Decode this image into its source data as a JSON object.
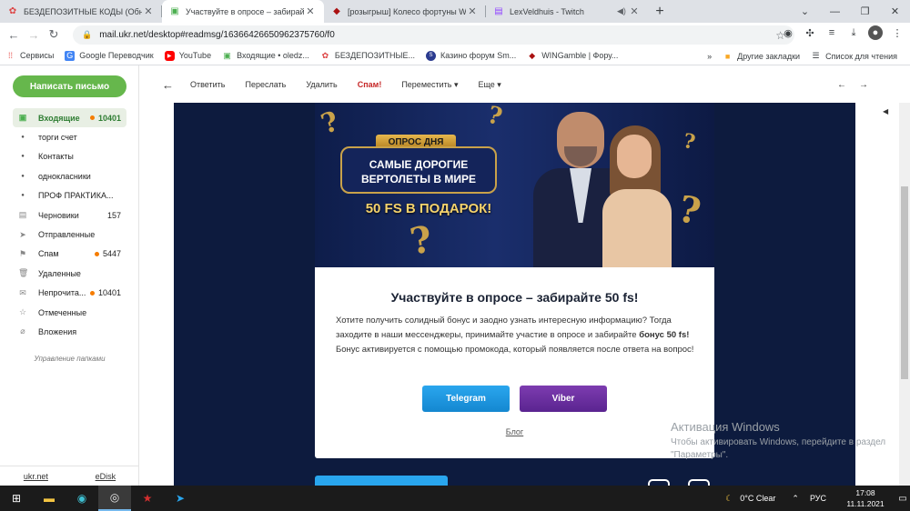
{
  "browser": {
    "tabs": [
      {
        "title": "БЕЗДЕПОЗИТНЫЕ КОДЫ (Обно",
        "icon": "flower-icon",
        "active": false
      },
      {
        "title": "Участвуйте в опросе – забирай",
        "icon": "ukrnet-icon",
        "active": true
      },
      {
        "title": "[розыгрыш] Колесо фортуны W",
        "icon": "wingamble-icon",
        "active": false
      },
      {
        "title": "LexVeldhuis - Twitch",
        "icon": "twitch-icon",
        "active": false
      }
    ],
    "url": "mail.ukr.net/desktop#readmsg/16366426650962375760/f0",
    "bookmarks": [
      {
        "label": "Сервисы",
        "icon": "apps-icon"
      },
      {
        "label": "Google Переводчик",
        "icon": "translate-icon"
      },
      {
        "label": "YouTube",
        "icon": "youtube-icon"
      },
      {
        "label": "Входящие • oledz...",
        "icon": "ukrnet-icon"
      },
      {
        "label": "БЕЗДЕПОЗИТНЫЕ...",
        "icon": "flower-icon"
      },
      {
        "label": "Казино форум Sm...",
        "icon": "casino-icon"
      },
      {
        "label": "WINGamble | Фору...",
        "icon": "wingamble-icon"
      }
    ],
    "bookmarks_more": "»",
    "other_bookmarks": "Другие закладки",
    "reading_list": "Список для чтения"
  },
  "sidebar": {
    "compose": "Написать письмо",
    "folders": [
      {
        "label": "Входящие",
        "count": "10401",
        "dot": true,
        "icon": "inbox-icon",
        "sub": false
      },
      {
        "label": "торги счет",
        "count": "",
        "dot": false,
        "icon": "bullet-icon",
        "sub": true
      },
      {
        "label": "Контакты",
        "count": "",
        "dot": false,
        "icon": "bullet-icon",
        "sub": true
      },
      {
        "label": "однокласники",
        "count": "",
        "dot": false,
        "icon": "bullet-icon",
        "sub": true
      },
      {
        "label": "ПРОФ ПРАКТИКА...",
        "count": "",
        "dot": false,
        "icon": "bullet-icon",
        "sub": true
      },
      {
        "label": "Черновики",
        "count": "157",
        "dot": false,
        "icon": "draft-icon",
        "sub": false
      },
      {
        "label": "Отправленные",
        "count": "",
        "dot": false,
        "icon": "send-icon",
        "sub": false
      },
      {
        "label": "Спам",
        "count": "5447",
        "dot": true,
        "icon": "spam-icon",
        "sub": false
      },
      {
        "label": "Удаленные",
        "count": "",
        "dot": false,
        "icon": "trash-icon",
        "sub": false
      },
      {
        "label": "Непрочита...",
        "count": "10401",
        "dot": true,
        "icon": "unread-icon",
        "sub": false
      },
      {
        "label": "Отмеченные",
        "count": "",
        "dot": false,
        "icon": "star-icon",
        "sub": false
      },
      {
        "label": "Вложения",
        "count": "",
        "dot": false,
        "icon": "attachment-icon",
        "sub": false
      }
    ],
    "manage": "Управление папками",
    "footer": {
      "left": "ukr.net",
      "right": "eDisk"
    }
  },
  "toolbar": {
    "reply": "Ответить",
    "forward": "Переслать",
    "delete": "Удалить",
    "spam": "Спам!",
    "move": "Переместить ▾",
    "more": "Еще ▾"
  },
  "banner": {
    "badge": "ОПРОС ДНЯ",
    "title_line1": "САМЫЕ ДОРОГИЕ",
    "title_line2": "ВЕРТОЛЕТЫ В МИРЕ",
    "gift": "50 FS В ПОДАРОК!"
  },
  "message": {
    "heading": "Участвуйте в опросе – забирайте 50 fs!",
    "text1": "Хотите получить солидный бонус и заодно узнать интересную информацию? Тогда заходите в наши мессенджеры, принимайте участие в опросе и забирайте ",
    "text_bold": "бонус 50 fs!",
    "text2": " Бонус активируется с помощью промокода, который появляется после ответа на вопрос!",
    "btn_telegram": "Telegram",
    "btn_viber": "Viber",
    "blog": "Блог"
  },
  "watermark": {
    "title": "Активация Windows",
    "text": "Чтобы активировать Windows, перейдите в раздел \"Параметры\"."
  },
  "taskbar": {
    "weather": "0°C  Clear",
    "lang": "РУС",
    "time": "17:08",
    "date": "11.11.2021"
  },
  "colors": {
    "compose_green": "#66b74c",
    "spam_red": "#c62828",
    "telegram": "#1e9be0",
    "viber": "#6a2ea0",
    "banner_bg": "#0e1d4a",
    "gold": "#c9a24a"
  }
}
